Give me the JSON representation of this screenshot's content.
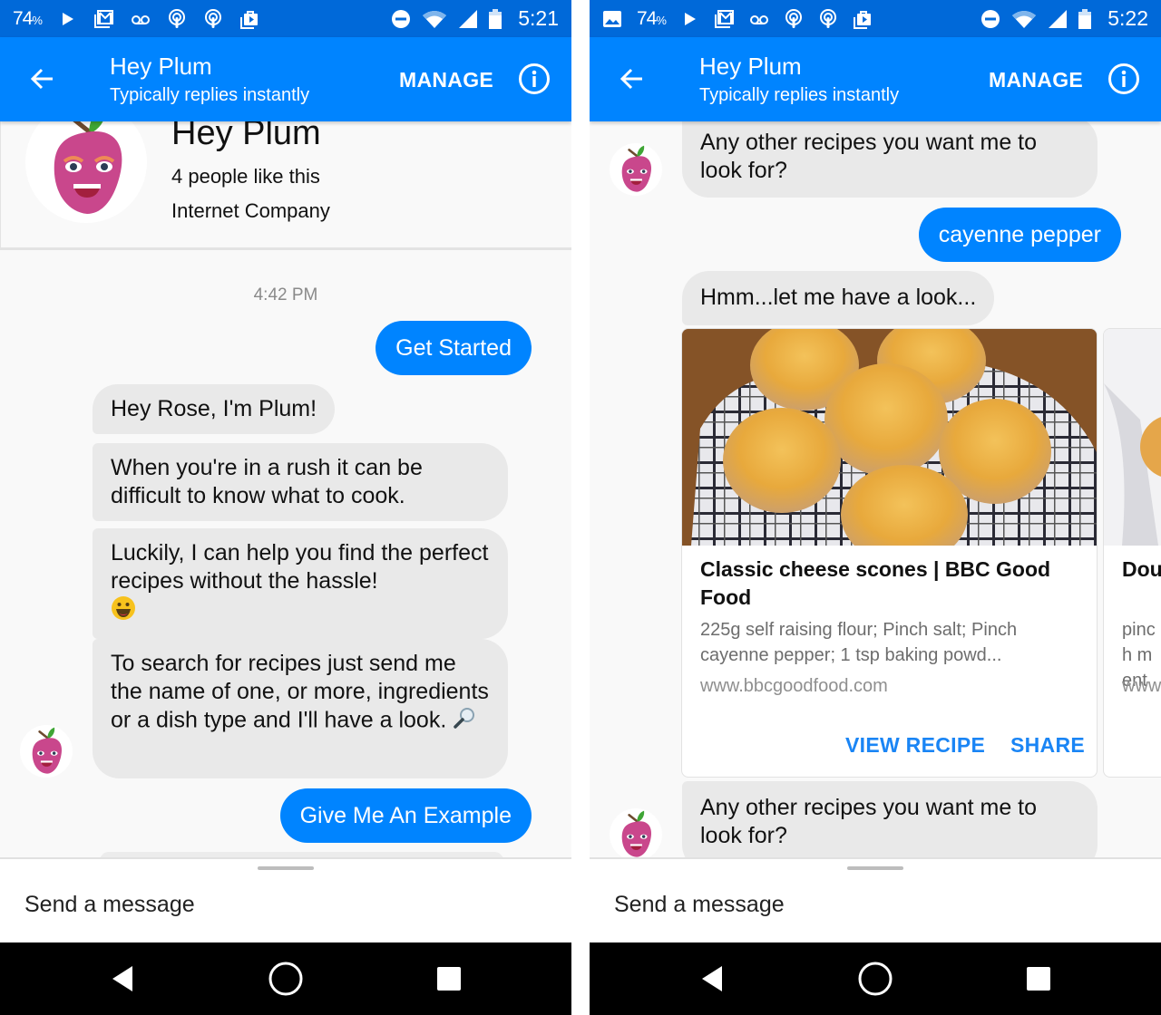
{
  "colors": {
    "status_bar": "#0069d9",
    "app_bar": "#0084ff",
    "outgoing_bubble": "#0084ff",
    "incoming_bubble": "#e9e9e9",
    "card_action": "#1a85f5"
  },
  "screens": [
    {
      "status_bar": {
        "battery_percent": "74",
        "percent_sign": "%",
        "time": "5:21",
        "left_icons": [
          "play-icon",
          "gmail-icon",
          "voicemail-icon",
          "podcast-icon",
          "podcast-icon",
          "play-store-icon"
        ],
        "right_icons": [
          "do-not-disturb-icon",
          "wifi-icon",
          "cell-signal-icon",
          "battery-icon"
        ]
      },
      "app_bar": {
        "back_icon": "arrow-left-icon",
        "title": "Hey Plum",
        "subtitle": "Typically replies instantly",
        "manage_label": "MANAGE",
        "info_icon": "info-icon"
      },
      "profile": {
        "name": "Hey Plum",
        "likes": "4 people like this",
        "category": "Internet Company"
      },
      "timestamp": "4:42 PM",
      "messages": [
        {
          "from": "user",
          "text": "Get Started"
        },
        {
          "from": "bot",
          "text": "Hey Rose, I'm Plum!"
        },
        {
          "from": "bot",
          "text": "When you're in a rush it can be difficult to know what to cook."
        },
        {
          "from": "bot",
          "text": "Luckily, I can help you find the perfect recipes without the hassle!",
          "emoji": "grinning-face"
        },
        {
          "from": "bot",
          "text": "To search for recipes just send me the name of one, or more, ingredients or a dish type and I'll have a look.",
          "emoji": "magnifying-glass"
        },
        {
          "from": "user",
          "text": "Give Me An Example"
        }
      ],
      "composer": {
        "placeholder": "Send a message"
      },
      "nav": [
        "back-icon",
        "home-icon",
        "recents-icon"
      ]
    },
    {
      "status_bar": {
        "battery_percent": "74",
        "percent_sign": "%",
        "time": "5:22",
        "left_icons": [
          "image-icon",
          "play-icon",
          "gmail-icon",
          "voicemail-icon",
          "podcast-icon",
          "podcast-icon",
          "play-store-icon"
        ],
        "right_icons": [
          "do-not-disturb-icon",
          "wifi-icon",
          "cell-signal-icon",
          "battery-icon"
        ]
      },
      "app_bar": {
        "back_icon": "arrow-left-icon",
        "title": "Hey Plum",
        "subtitle": "Typically replies instantly",
        "manage_label": "MANAGE",
        "info_icon": "info-icon"
      },
      "messages": [
        {
          "from": "bot",
          "text": "Any other recipes you want me to look for?"
        },
        {
          "from": "user",
          "text": "cayenne pepper"
        },
        {
          "from": "bot",
          "text": "Hmm...let me have a look..."
        },
        {
          "from": "bot",
          "text": "Any other recipes you want me to look for?"
        }
      ],
      "cards": [
        {
          "title": "Classic cheese scones | BBC Good Food",
          "description": "225g self raising flour; Pinch salt; Pinch cayenne pepper; 1 tsp baking powd...",
          "url": "www.bbcgoodfood.com",
          "actions": [
            "VIEW RECIPE",
            "SHARE"
          ]
        },
        {
          "title": "Dou Goo",
          "description": "pinch ment",
          "url": "www"
        }
      ],
      "composer": {
        "placeholder": "Send a message"
      },
      "nav": [
        "back-icon",
        "home-icon",
        "recents-icon"
      ]
    }
  ]
}
